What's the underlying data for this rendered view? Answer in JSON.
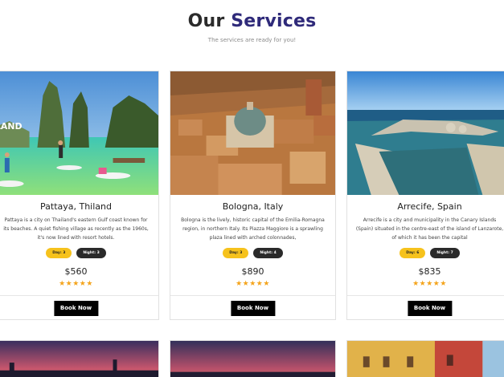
{
  "section": {
    "title_part1": "Our",
    "title_part2": "Services",
    "subtitle": "The services are ready for you!"
  },
  "cards": [
    {
      "title": "Pattaya, Thiland",
      "description": "Pattaya is a city on Thailand's eastern Gulf coast known for its beaches. A quiet fishing village as recently as the 1960s, it's now lined with resort hotels.",
      "day": "Day: 3",
      "night": "Night: 3",
      "price": "$560",
      "stars": "★★★★★",
      "button": "Book Now"
    },
    {
      "title": "Bologna, Italy",
      "description": "Bologna is the lively, historic capital of the Emilia-Romagna region, in northern Italy. Its Piazza Maggiore is a sprawling plaza lined with arched colonnades,",
      "day": "Day: 3",
      "night": "Night: 4",
      "price": "$890",
      "stars": "★★★★★",
      "button": "Book Now"
    },
    {
      "title": "Arrecife, Spain",
      "description": "Arrecife is a city and municipality in the Canary Islands (Spain) situated in the centre-east of the island of Lanzarote, of which it has been the capital",
      "day": "Day: 6",
      "night": "Night: 7",
      "price": "$835",
      "stars": "★★★★★",
      "button": "Book Now"
    }
  ],
  "colors": {
    "accent_title": "#2f2a7a",
    "day_pill": "#f6c21c",
    "night_pill": "#2a2a2a",
    "stars": "#f4a41c",
    "button": "#000000"
  }
}
